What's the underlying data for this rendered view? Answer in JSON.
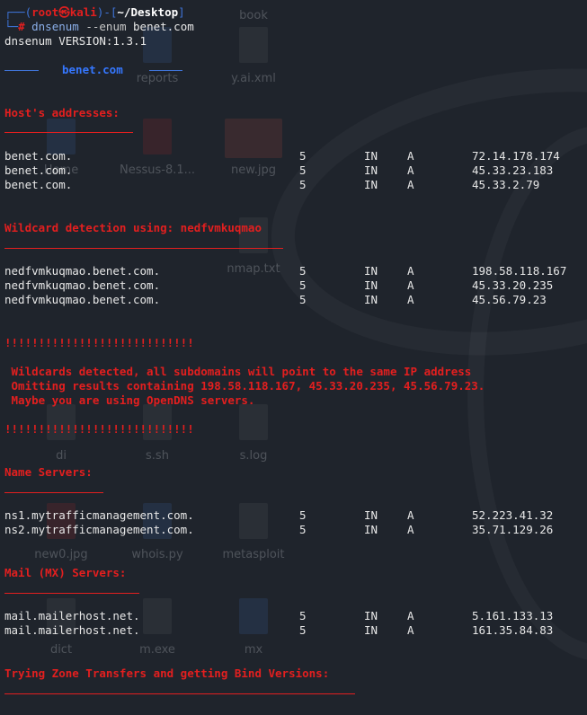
{
  "desktop_icons": [
    {
      "label": "book",
      "kind": "file"
    },
    {
      "label": "reports",
      "kind": "blue"
    },
    {
      "label": "y.ai.xml",
      "kind": "file"
    },
    {
      "label": "Home",
      "kind": "blue"
    },
    {
      "label": "Nessus-8.1...",
      "kind": "red"
    },
    {
      "label": "new.jpg",
      "kind": "pic"
    },
    {
      "label": "nmap.txt",
      "kind": "file"
    },
    {
      "label": "di",
      "kind": "file"
    },
    {
      "label": "s.sh",
      "kind": "file"
    },
    {
      "label": "s.log",
      "kind": "file"
    },
    {
      "label": "new0.jpg",
      "kind": "red"
    },
    {
      "label": "whois.py",
      "kind": "blue"
    },
    {
      "label": "metasploit",
      "kind": "file"
    },
    {
      "label": "dict",
      "kind": "file"
    },
    {
      "label": "m.exe",
      "kind": "file"
    },
    {
      "label": "mx",
      "kind": "blue"
    }
  ],
  "prompt": {
    "corner_top": "┌──(",
    "user": "root㉿kali",
    "mid": ")-[",
    "path": "~/Desktop",
    "end": "]",
    "corner_bottom": "└─",
    "hash": "#",
    "command": "dnsenum",
    "option": "--enum",
    "target": "benet.com"
  },
  "version_line": "dnsenum VERSION:1.3.1",
  "banner": {
    "dashes_left": "─────",
    "title": "benet.com",
    "dashes_right": "─────"
  },
  "sections": {
    "hosts_title": "Host's addresses:",
    "hosts_underline": "__________________",
    "wildcard_title": "Wildcard detection using: nedfvmkuqmao",
    "wildcard_underline": "_______________________________________",
    "bang_line": "!!!!!!!!!!!!!!!!!!!!!!!!!!!!",
    "warning_1": " Wildcards detected, all subdomains will point to the same IP address",
    "warning_2": " Omitting results containing 198.58.118.167, 45.33.20.235, 45.56.79.23.",
    "warning_3": " Maybe you are using OpenDNS servers.",
    "ns_title": "Name Servers:",
    "ns_underline": "______________",
    "mx_title": "Mail (MX) Servers:",
    "mx_underline": "___________________",
    "zone_title": "Trying Zone Transfers and getting Bind Versions:",
    "zone_underline": "_________________________________________________"
  },
  "hosts": [
    {
      "name": "benet.com.",
      "ttl": "5",
      "class": "IN",
      "type": "A",
      "ip": "72.14.178.174"
    },
    {
      "name": "benet.com.",
      "ttl": "5",
      "class": "IN",
      "type": "A",
      "ip": "45.33.23.183"
    },
    {
      "name": "benet.com.",
      "ttl": "5",
      "class": "IN",
      "type": "A",
      "ip": "45.33.2.79"
    }
  ],
  "wildcards": [
    {
      "name": "nedfvmkuqmao.benet.com.",
      "ttl": "5",
      "class": "IN",
      "type": "A",
      "ip": "198.58.118.167"
    },
    {
      "name": "nedfvmkuqmao.benet.com.",
      "ttl": "5",
      "class": "IN",
      "type": "A",
      "ip": "45.33.20.235"
    },
    {
      "name": "nedfvmkuqmao.benet.com.",
      "ttl": "5",
      "class": "IN",
      "type": "A",
      "ip": "45.56.79.23"
    }
  ],
  "nameservers": [
    {
      "name": "ns1.mytrafficmanagement.com.",
      "ttl": "5",
      "class": "IN",
      "type": "A",
      "ip": "52.223.41.32"
    },
    {
      "name": "ns2.mytrafficmanagement.com.",
      "ttl": "5",
      "class": "IN",
      "type": "A",
      "ip": "35.71.129.26"
    }
  ],
  "mailservers": [
    {
      "name": "mail.mailerhost.net.",
      "ttl": "5",
      "class": "IN",
      "type": "A",
      "ip": "5.161.133.13"
    },
    {
      "name": "mail.mailerhost.net.",
      "ttl": "5",
      "class": "IN",
      "type": "A",
      "ip": "161.35.84.83"
    }
  ],
  "colors": {
    "background": "#1f242c",
    "heading": "#e31f1f",
    "accent": "#3577ff",
    "text": "#e8e8e8"
  }
}
